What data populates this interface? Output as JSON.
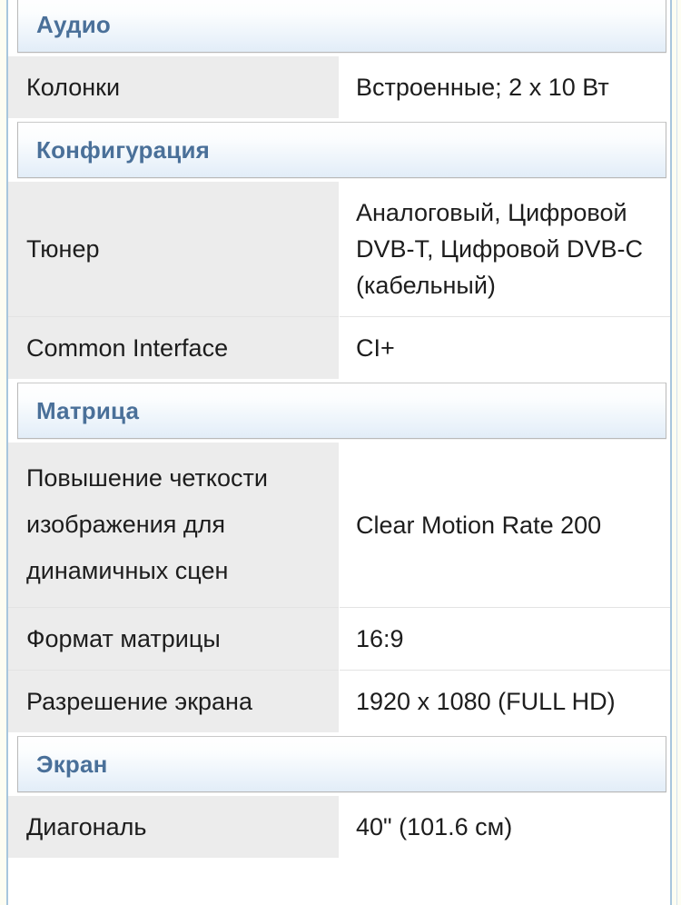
{
  "page": {
    "type": "product-specification-table",
    "language": "ru",
    "colors": {
      "section_header_text": "#4a7099",
      "section_header_gradient_top": "#ffffff",
      "section_header_gradient_bottom": "#e2edf8",
      "label_column_background": "#ececec",
      "value_column_background": "#ffffff",
      "body_text": "#1d1d1d",
      "page_gutter": "#fdfdf2",
      "gutter_rule": "#a8c6dd",
      "row_separator": "#e3e3e3"
    }
  },
  "sections": [
    {
      "title": "Аудио",
      "rows": [
        {
          "label": "Колонки",
          "value": "Встроенные; 2 x 10 Вт",
          "tall": false
        }
      ]
    },
    {
      "title": "Конфигурация",
      "rows": [
        {
          "label": "Тюнер",
          "value": "Аналоговый, Цифровой DVB-T, Цифровой DVB-C (кабельный)",
          "tall": false
        },
        {
          "label": "Common Interface",
          "value": "CI+",
          "tall": false
        }
      ]
    },
    {
      "title": "Матрица",
      "rows": [
        {
          "label": "Повышение четкости изображения для динамичных сцен",
          "value": "Clear Motion Rate 200",
          "tall": true
        },
        {
          "label": "Формат матрицы",
          "value": "16:9",
          "tall": false
        },
        {
          "label": "Разрешение экрана",
          "value": "1920 x 1080 (FULL HD)",
          "tall": false
        }
      ]
    },
    {
      "title": "Экран",
      "rows": [
        {
          "label": "Диагональ",
          "value": "40\" (101.6 см)",
          "tall": false
        }
      ]
    }
  ]
}
